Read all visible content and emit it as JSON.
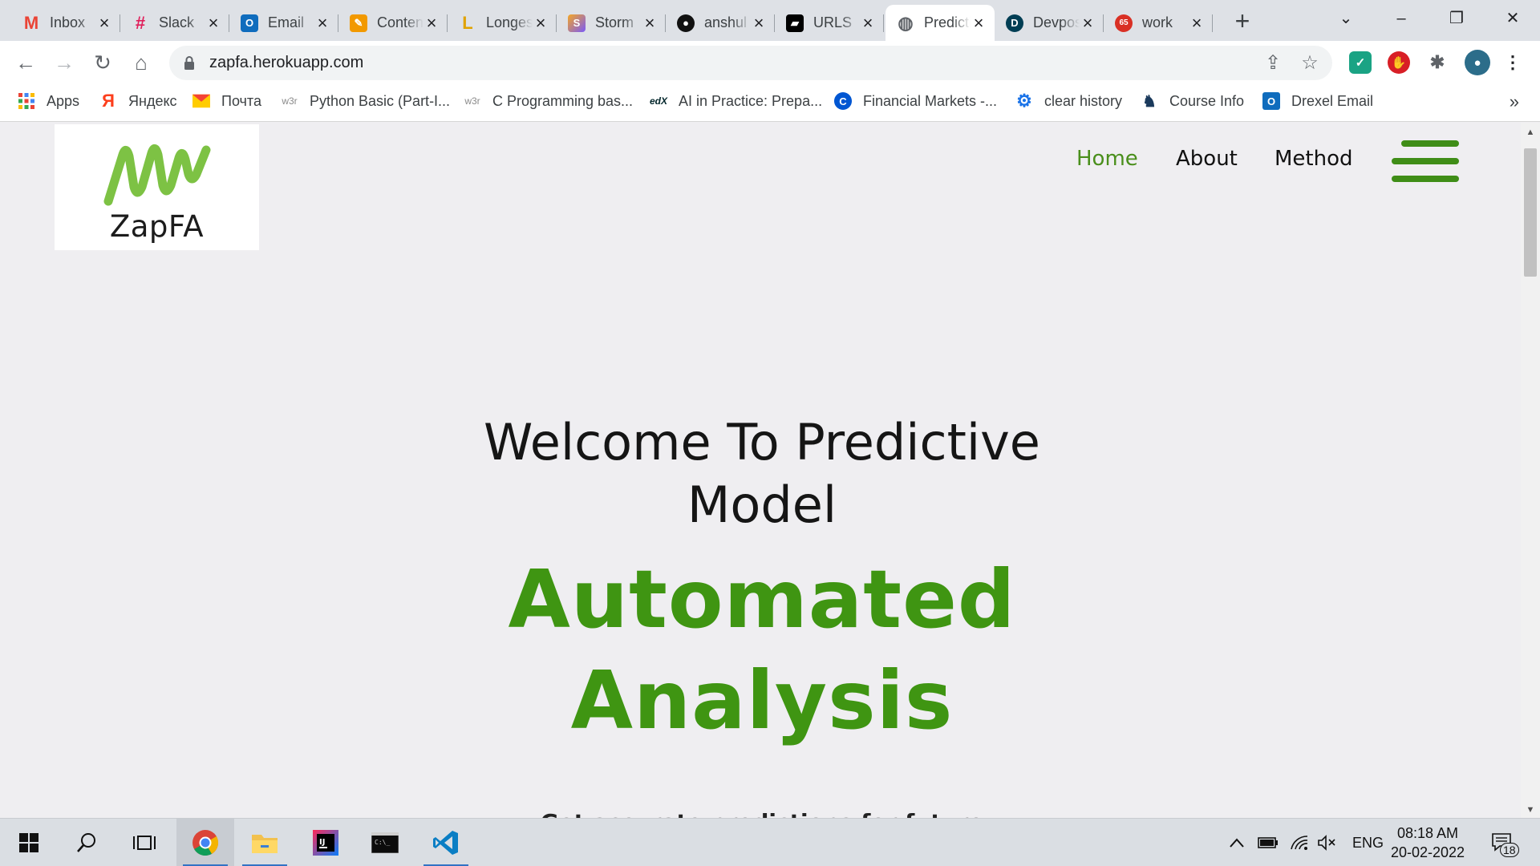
{
  "browser": {
    "tabs": [
      {
        "title": "Inbox",
        "icon": "gmail-icon",
        "fav": "M",
        "color": "#ea4335"
      },
      {
        "title": "Slack",
        "icon": "slack-icon",
        "fav": "#",
        "color": "#611f69"
      },
      {
        "title": "Email",
        "icon": "outlook-icon",
        "fav": "O",
        "color": "#0f6cbd"
      },
      {
        "title": "Content",
        "icon": "notes-icon",
        "fav": "✎",
        "color": "#f29900"
      },
      {
        "title": "Longest",
        "icon": "leetcode-icon",
        "fav": "L",
        "color": "#e0a200"
      },
      {
        "title": "Storm",
        "icon": "storm-icon",
        "fav": "S",
        "color": "#7a5af8"
      },
      {
        "title": "anshul",
        "icon": "github-icon",
        "fav": "●",
        "color": "#111111"
      },
      {
        "title": "URLS",
        "icon": "urls-icon",
        "fav": "▰",
        "color": "#000000"
      },
      {
        "title": "Predictive",
        "icon": "globe-icon",
        "fav": "◍",
        "color": "#5f6368"
      },
      {
        "title": "Devpost",
        "icon": "devpost-icon",
        "fav": "D",
        "color": "#003e54"
      },
      {
        "title": "work",
        "icon": "work-icon",
        "fav": "65",
        "color": "#d93025"
      }
    ],
    "active_tab_index": 8,
    "url": "zapfa.herokuapp.com",
    "bookmarks": [
      {
        "label": "Apps",
        "icon": "apps-grid-icon"
      },
      {
        "label": "Яндекс",
        "icon": "yandex-icon"
      },
      {
        "label": "Почта",
        "icon": "mail-icon"
      },
      {
        "label": "Python Basic (Part-I...",
        "icon": "w3r-icon"
      },
      {
        "label": "C Programming bas...",
        "icon": "w3r-icon"
      },
      {
        "label": "AI in Practice: Prepa...",
        "icon": "edx-icon"
      },
      {
        "label": "Financial Markets -...",
        "icon": "coursera-icon"
      },
      {
        "label": "clear history",
        "icon": "gear-icon"
      },
      {
        "label": "Course Info",
        "icon": "dragon-icon"
      },
      {
        "label": "Drexel Email",
        "icon": "outlook-icon"
      }
    ],
    "bookmarks_more": "»"
  },
  "site": {
    "logo_text": "ZapFA",
    "nav": [
      "Home",
      "About",
      "Method"
    ],
    "active_nav": "Home",
    "welcome_line1": "Welcome To Predictive",
    "welcome_line2": "Model",
    "headline_line1": "Automated",
    "headline_line2": "Analysis",
    "subtext": "Get accurate predictions for future"
  },
  "taskbar": {
    "language": "ENG",
    "time": "08:18 AM",
    "date": "20-02-2022",
    "notifications": "18"
  },
  "colors": {
    "brand_green": "#3f9512",
    "nav_active": "#4a8f1c"
  }
}
